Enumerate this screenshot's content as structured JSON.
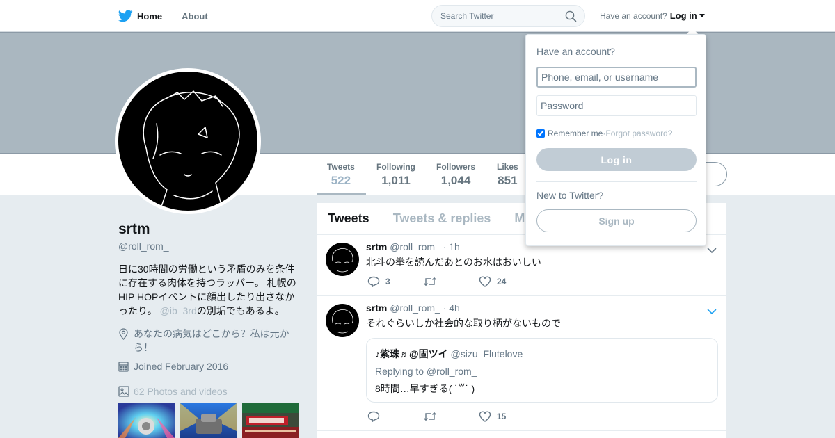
{
  "colors": {
    "brand": "#1da1f2",
    "banner": "#aab7c0",
    "muted": "#657786",
    "background": "#e6ecf0"
  },
  "nav": {
    "home_label": "Home",
    "about_label": "About",
    "search_placeholder": "Search Twitter",
    "have_account": "Have an account?",
    "login_label": "Log in"
  },
  "profile": {
    "name": "srtm",
    "handle": "@roll_rom_",
    "bio_main": "日に30時間の労働という矛盾のみを条件に存在する肉体を持つラッパー。 札幌のHIP HOPイベントに顔出したり出さなかったり。 ",
    "bio_mention": "@ib_3rd",
    "bio_tail": "の別垢でもあるよ。",
    "location": "あなたの病気はどこから？私は元から！",
    "joined": "Joined February 2016",
    "photos": "62 Photos and videos",
    "stats": [
      {
        "label": "Tweets",
        "value": "522"
      },
      {
        "label": "Following",
        "value": "1,011"
      },
      {
        "label": "Followers",
        "value": "1,044"
      },
      {
        "label": "Likes",
        "value": "851"
      }
    ]
  },
  "timeline": {
    "tabs": [
      "Tweets",
      "Tweets & replies",
      "M"
    ],
    "tweets": [
      {
        "name": "srtm",
        "handle": "@roll_rom_",
        "time": "· 1h",
        "text": "北斗の拳を読んだあとのお水はおいしい",
        "replies": "3",
        "retweets": "",
        "likes": "24"
      },
      {
        "name": "srtm",
        "handle": "@roll_rom_",
        "time": "· 4h",
        "text": "それぐらいしか社会的な取り柄がないもので",
        "replies": "",
        "retweets": "",
        "likes": "15",
        "quote": {
          "name": "♪紫珠♬@固ツイ",
          "handle": "@sizu_Flutelove",
          "replying": "Replying to @roll_rom_",
          "text": "8時間…早すぎる( ˙꒳˙ )"
        }
      }
    ]
  },
  "login_dropdown": {
    "title": "Have an account?",
    "username_placeholder": "Phone, email, or username",
    "password_placeholder": "Password",
    "remember_me": "Remember me",
    "separator": " · ",
    "forgot_password": "Forgot password?",
    "login_button": "Log in",
    "new_to_twitter": "New to Twitter?",
    "signup_button": "Sign up"
  }
}
